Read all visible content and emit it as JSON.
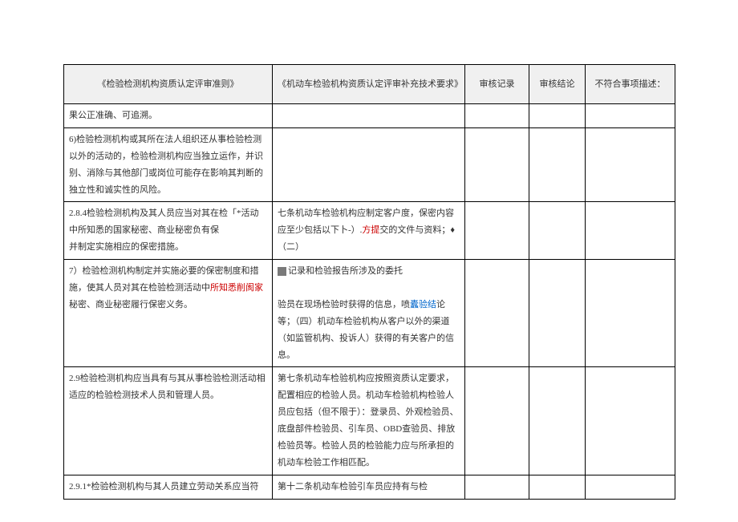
{
  "header": {
    "col1": "《检验检测机构资质认定评审准则》",
    "col2": "《机动车检验机构资质认定评审补充技术要求》",
    "col3": "审核记录",
    "col4": "审核结论",
    "col5": "不符合事项描述："
  },
  "rows": [
    {
      "left": "果公正准确、可追溯。",
      "right": ""
    },
    {
      "left": "6)检验检测机构或其所在法人组织还从事检验检测以外的活动的，检验检测机构应当独立运作，并识别、消除与其他部门或岗位可能存在影响其判断的独立性和诚实性的风险。",
      "right": ""
    },
    {
      "leftHtml": "2.8.4检验检测机构及其人员应当对其在检「*活动中所知悉的国家秘密、商业秘密负有保<br>并制定实施相应的保密措施。",
      "rightHtml": "七条机动车检验机构应制定客户度，保密内容应至少包括以下卜-）.<span class='red'>方提</span>交的文件与资料；♦（二）"
    },
    {
      "leftHtml": "7）检验检测机构制定并实施必要的保密制度和措施，使其人员对其在检验检测活动中<span class='red'>所知悉削阂家</span>秘密、商业秘密履行保密义务。",
      "rightHtml": "<span class='gray-box'></span>记录和检验报告所涉及的委托<br><br>验员在现场检验时获得的信息，喷<span class='blue'>蠹验结</span>论等；（四）机动车检验机构从客户以外的渠道（如监管机构、投诉人）获得的有关客户的信息。"
    },
    {
      "left": "2.9检验检测机构应当具有与其从事检验检测活动相适应的检验检测技术人员和管理人员。",
      "right": "第七条机动车检验机构应按照资质认定要求，配置相应的检验人员。机动车检验机构检验人员应包括（但不限于）：登录员、外观检验员、底盘部件检验员、引车员、OBD查验员、排放检验员等。检验人员的检验能力应与所承担的机动车检验工作相匹配。"
    },
    {
      "left": "2.9.1*检验检测机构与其人员建立劳动关系应当符",
      "right": "第十二条机动车检验引车员应持有与检"
    }
  ]
}
